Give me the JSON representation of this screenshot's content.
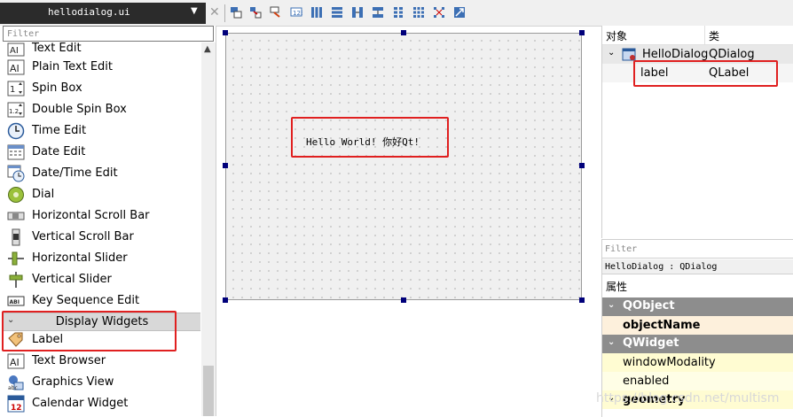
{
  "filetab": {
    "name": "hellodialog.ui",
    "dropdown": "▼",
    "close": "✕"
  },
  "widget_box": {
    "filter_placeholder": "Filter",
    "items_top": [
      {
        "label": "Text Edit",
        "icon": "text-edit-icon"
      },
      {
        "label": "Plain Text Edit",
        "icon": "plain-text-edit-icon"
      },
      {
        "label": "Spin Box",
        "icon": "spin-box-icon"
      },
      {
        "label": "Double Spin Box",
        "icon": "double-spin-box-icon"
      },
      {
        "label": "Time Edit",
        "icon": "clock-icon"
      },
      {
        "label": "Date Edit",
        "icon": "calendar-icon"
      },
      {
        "label": "Date/Time Edit",
        "icon": "datetime-icon"
      },
      {
        "label": "Dial",
        "icon": "dial-icon"
      },
      {
        "label": "Horizontal Scroll Bar",
        "icon": "hscrollbar-icon"
      },
      {
        "label": "Vertical Scroll Bar",
        "icon": "vscrollbar-icon"
      },
      {
        "label": "Horizontal Slider",
        "icon": "hslider-icon"
      },
      {
        "label": "Vertical Slider",
        "icon": "vslider-icon"
      },
      {
        "label": "Key Sequence Edit",
        "icon": "key-sequence-icon"
      }
    ],
    "category": "Display Widgets",
    "items_bottom": [
      {
        "label": "Label",
        "icon": "label-tag-icon"
      },
      {
        "label": "Text Browser",
        "icon": "text-browser-icon"
      },
      {
        "label": "Graphics View",
        "icon": "graphics-view-icon"
      },
      {
        "label": "Calendar Widget",
        "icon": "calendar-widget-icon"
      }
    ]
  },
  "canvas": {
    "label_text": "Hello World! 你好Qt!"
  },
  "object_inspector": {
    "col_object": "对象",
    "col_class": "类",
    "rows": [
      {
        "object": "HelloDialog",
        "class": "QDialog"
      },
      {
        "object": "label",
        "class": "QLabel"
      }
    ]
  },
  "property_editor": {
    "filter_placeholder": "Filter",
    "class_line": "HelloDialog : QDialog",
    "attr_header": "属性",
    "groups": [
      {
        "name": "QObject"
      },
      {
        "name": "QWidget"
      }
    ],
    "rows": [
      "objectName",
      "windowModality",
      "enabled",
      "geometry"
    ]
  },
  "watermark": "https://blog.csdn.net/multism",
  "colors": {
    "highlight_red": "#e02020",
    "handle_blue": "#00007a",
    "group_gray": "#8d8d8d",
    "row_cream": "#fdf0dc",
    "row_yellow": "#fffcd2"
  }
}
